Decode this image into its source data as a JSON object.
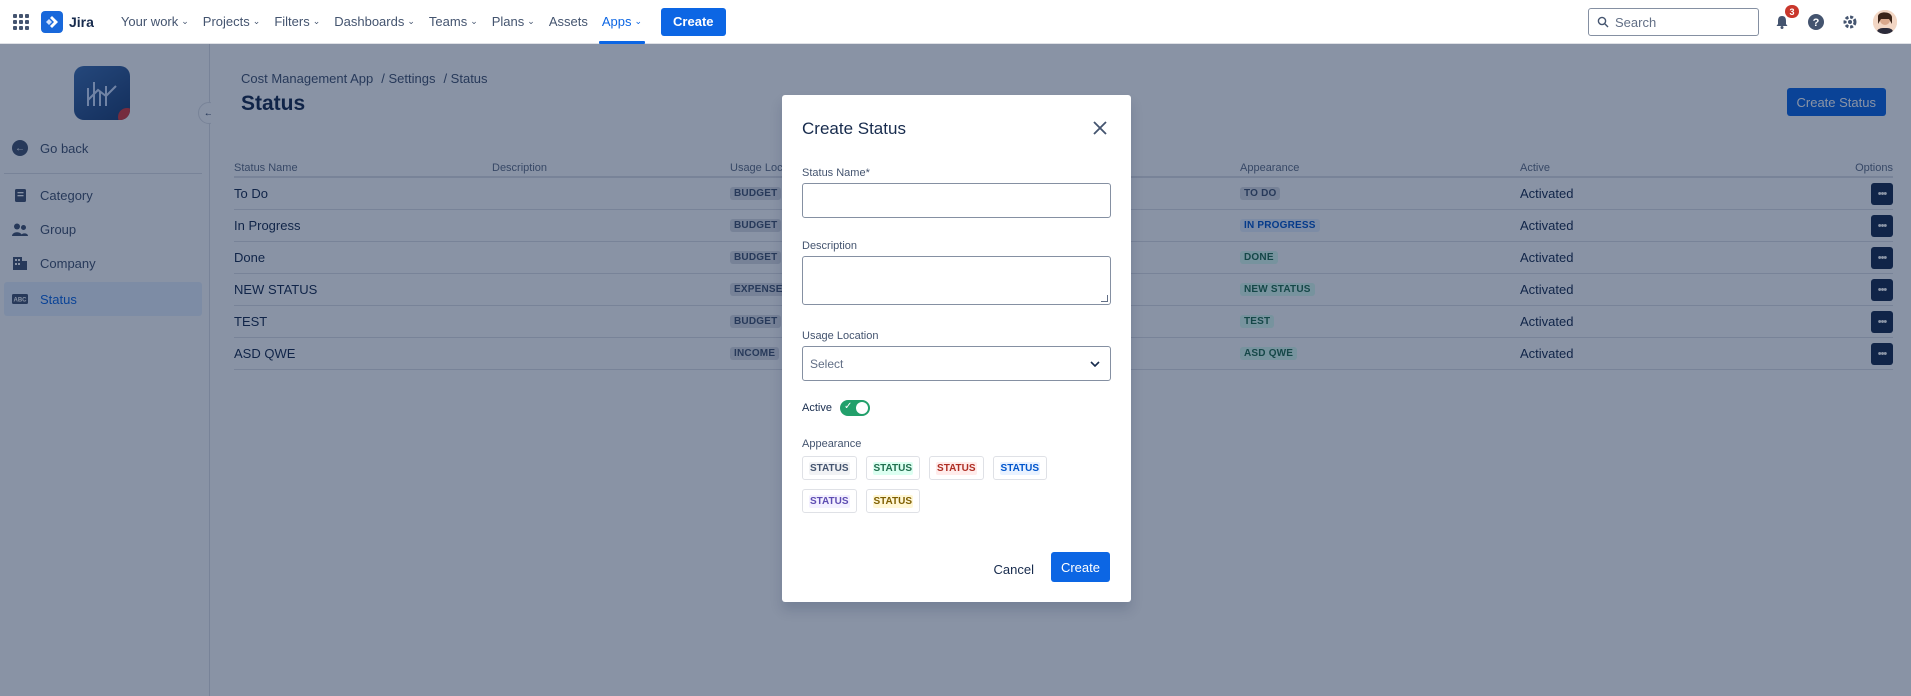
{
  "topnav": {
    "logo_text": "Jira",
    "items": [
      {
        "label": "Your work"
      },
      {
        "label": "Projects"
      },
      {
        "label": "Filters"
      },
      {
        "label": "Dashboards"
      },
      {
        "label": "Teams"
      },
      {
        "label": "Plans"
      },
      {
        "label": "Assets"
      },
      {
        "label": "Apps"
      }
    ],
    "create_label": "Create",
    "search_placeholder": "Search",
    "notification_count": "3"
  },
  "sidebar": {
    "back_label": "Go back",
    "items": [
      {
        "label": "Category",
        "icon": "document-icon"
      },
      {
        "label": "Group",
        "icon": "people-icon"
      },
      {
        "label": "Company",
        "icon": "building-icon"
      },
      {
        "label": "Status",
        "icon": "abc-icon",
        "selected": true
      }
    ]
  },
  "page": {
    "breadcrumb": [
      "Cost Management App",
      "/ Settings",
      "/ Status"
    ],
    "title": "Status",
    "create_status_label": "Create Status"
  },
  "table": {
    "headers": [
      "Status Name",
      "Description",
      "Usage Loca",
      "Appearance",
      "Active",
      "Options"
    ],
    "rows": [
      {
        "name": "To Do",
        "usage": "BUDGET",
        "appearance": "TO DO",
        "appearance_style": "grey",
        "active": "Activated"
      },
      {
        "name": "In Progress",
        "usage": "BUDGET",
        "appearance": "IN PROGRESS",
        "appearance_style": "blue",
        "active": "Activated"
      },
      {
        "name": "Done",
        "usage": "BUDGET",
        "appearance": "DONE",
        "appearance_style": "green",
        "active": "Activated"
      },
      {
        "name": "NEW STATUS",
        "usage": "EXPENSE",
        "appearance": "NEW STATUS",
        "appearance_style": "green",
        "active": "Activated"
      },
      {
        "name": "TEST",
        "usage": "BUDGET",
        "appearance": "TEST",
        "appearance_style": "green",
        "active": "Activated"
      },
      {
        "name": "ASD QWE",
        "usage": "INCOME",
        "appearance": "ASD QWE",
        "appearance_style": "green",
        "active": "Activated"
      }
    ]
  },
  "modal": {
    "title": "Create Status",
    "status_name_label": "Status Name*",
    "status_name_value": "",
    "description_label": "Description",
    "usage_location_label": "Usage Location",
    "usage_location_value": "Select",
    "active_label": "Active",
    "active_on": true,
    "appearance_label": "Appearance",
    "swatches": [
      {
        "label": "STATUS",
        "color": "#44546f"
      },
      {
        "label": "STATUS",
        "color": "#216e4e"
      },
      {
        "label": "STATUS",
        "color": "#ae2e24"
      },
      {
        "label": "STATUS",
        "color": "#0055cc"
      },
      {
        "label": "STATUS",
        "color": "#5e4db2"
      },
      {
        "label": "STATUS",
        "color": "#7f5f01"
      }
    ],
    "cancel_label": "Cancel",
    "create_label": "Create"
  },
  "colors": {
    "brand": "#0c66e4",
    "toggle_on": "#22a06b",
    "overlay": "#091e42"
  }
}
